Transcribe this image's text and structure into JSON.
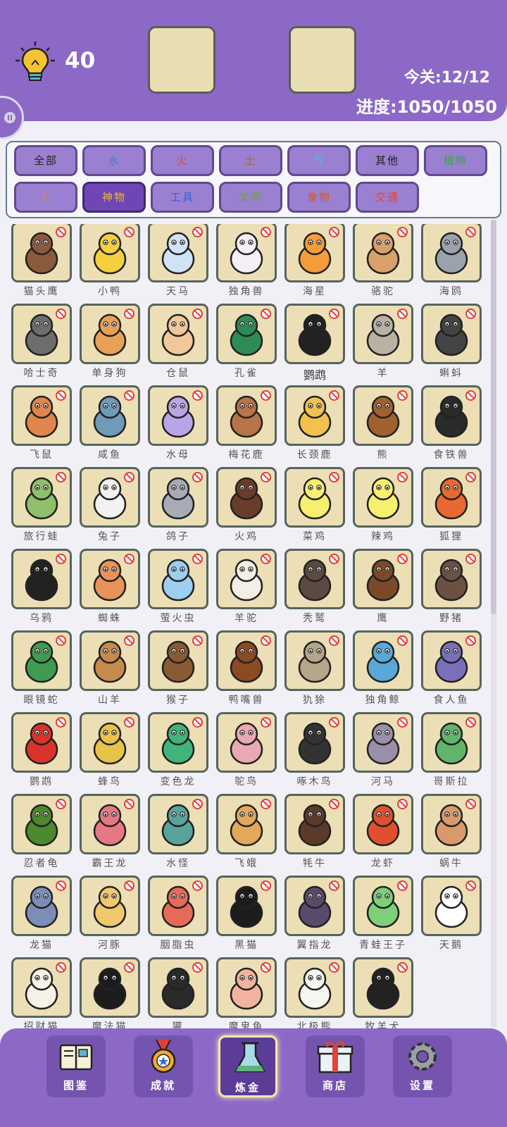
{
  "hints": {
    "count": "40"
  },
  "level": {
    "text": "今关:12/12"
  },
  "progress": {
    "text": "进度:1050/1050"
  },
  "filters": [
    {
      "label": "全部",
      "color": "#222222"
    },
    {
      "label": "水",
      "color": "#3b7fd6"
    },
    {
      "label": "火",
      "color": "#e04a3a"
    },
    {
      "label": "土",
      "color": "#a36b2c"
    },
    {
      "label": "气",
      "color": "#56b7d9"
    },
    {
      "label": "其他",
      "color": "#222222"
    },
    {
      "label": "植物",
      "color": "#3fa14a"
    },
    {
      "label": "人",
      "color": "#d4894a"
    },
    {
      "label": "神物",
      "color": "#f2b531",
      "active": true
    },
    {
      "label": "工具",
      "color": "#3a5fd6"
    },
    {
      "label": "文明",
      "color": "#6fa046"
    },
    {
      "label": "食物",
      "color": "#d05a20"
    },
    {
      "label": "交通",
      "color": "#e0443a"
    }
  ],
  "grid_items": [
    {
      "name": "猫头鹰",
      "icon": "owl-icon",
      "color": "#8b5a3c"
    },
    {
      "name": "小鸭",
      "icon": "duck-icon",
      "color": "#f4d03f"
    },
    {
      "name": "天马",
      "icon": "pegasus-icon",
      "color": "#cfe3f5"
    },
    {
      "name": "独角兽",
      "icon": "unicorn-icon",
      "color": "#f5f0f8"
    },
    {
      "name": "海星",
      "icon": "starfish-icon",
      "color": "#f39c3c"
    },
    {
      "name": "骆驼",
      "icon": "camel-icon",
      "color": "#d9a06b"
    },
    {
      "name": "海鸥",
      "icon": "seagull-icon",
      "color": "#9aa3ad"
    },
    {
      "name": "哈士奇",
      "icon": "husky-icon",
      "color": "#6d6d6d"
    },
    {
      "name": "单身狗",
      "icon": "dog-icon",
      "color": "#e6a157"
    },
    {
      "name": "仓鼠",
      "icon": "hamster-icon",
      "color": "#f1c89a"
    },
    {
      "name": "孔雀",
      "icon": "peacock-icon",
      "color": "#2e8b57"
    },
    {
      "name": "鹦鹉",
      "icon": "toucan-icon",
      "color": "#222222",
      "plain": true
    },
    {
      "name": "羊",
      "icon": "goat-icon",
      "color": "#b9b1a3"
    },
    {
      "name": "蝌蚪",
      "icon": "tadpole-icon",
      "color": "#444444"
    },
    {
      "name": "飞鼠",
      "icon": "flying-squirrel-icon",
      "color": "#e0864a"
    },
    {
      "name": "咸鱼",
      "icon": "salted-fish-icon",
      "color": "#6f9ab8"
    },
    {
      "name": "水母",
      "icon": "jellyfish-icon",
      "color": "#b9a5e6"
    },
    {
      "name": "梅花鹿",
      "icon": "deer-icon",
      "color": "#b8734a"
    },
    {
      "name": "长颈鹿",
      "icon": "giraffe-icon",
      "color": "#f2c14e"
    },
    {
      "name": "熊",
      "icon": "bear-icon",
      "color": "#a0612e"
    },
    {
      "name": "食铁兽",
      "icon": "panda-icon",
      "color": "#2b2b2b"
    },
    {
      "name": "旅行蛙",
      "icon": "frog-icon",
      "color": "#8fbf6a"
    },
    {
      "name": "兔子",
      "icon": "rabbit-icon",
      "color": "#f2f2f2"
    },
    {
      "name": "鸽子",
      "icon": "pigeon-icon",
      "color": "#a6abb5"
    },
    {
      "name": "火鸡",
      "icon": "turkey-icon",
      "color": "#6a3d2a"
    },
    {
      "name": "菜鸡",
      "icon": "chick-icon",
      "color": "#f7ef6e"
    },
    {
      "name": "辣鸡",
      "icon": "spicy-chick-icon",
      "color": "#f7ef6e"
    },
    {
      "name": "狐狸",
      "icon": "fox-icon",
      "color": "#e8692f"
    },
    {
      "name": "乌鸦",
      "icon": "crow-icon",
      "color": "#222222"
    },
    {
      "name": "蜘蛛",
      "icon": "spider-icon",
      "color": "#e8935a"
    },
    {
      "name": "萤火虫",
      "icon": "firefly-icon",
      "color": "#9dcff0"
    },
    {
      "name": "羊驼",
      "icon": "alpaca-icon",
      "color": "#f3efe6"
    },
    {
      "name": "秃鹫",
      "icon": "vulture-icon",
      "color": "#5a4a42"
    },
    {
      "name": "鹰",
      "icon": "eagle-icon",
      "color": "#7a4a28"
    },
    {
      "name": "野猪",
      "icon": "boar-icon",
      "color": "#6b5144"
    },
    {
      "name": "眼镜蛇",
      "icon": "snake-icon",
      "color": "#3e9b50"
    },
    {
      "name": "山羊",
      "icon": "mountain-goat-icon",
      "color": "#c68a4c"
    },
    {
      "name": "猴子",
      "icon": "monkey-icon",
      "color": "#8a5a32"
    },
    {
      "name": "鸭嘴兽",
      "icon": "platypus-icon",
      "color": "#8a4a22"
    },
    {
      "name": "犰狳",
      "icon": "armadillo-icon",
      "color": "#b6a58a"
    },
    {
      "name": "独角鲸",
      "icon": "narwhal-icon",
      "color": "#5aa8d8"
    },
    {
      "name": "食人鱼",
      "icon": "piranha-icon",
      "color": "#7a6fb8"
    },
    {
      "name": "鹦鹉",
      "icon": "parrot-icon",
      "color": "#d9332b"
    },
    {
      "name": "蜂鸟",
      "icon": "hummingbird-icon",
      "color": "#e7c34a"
    },
    {
      "name": "变色龙",
      "icon": "chameleon-icon",
      "color": "#3fb57a"
    },
    {
      "name": "鸵鸟",
      "icon": "ostrich-icon",
      "color": "#e8a9b3"
    },
    {
      "name": "啄木鸟",
      "icon": "woodpecker-icon",
      "color": "#333333"
    },
    {
      "name": "河马",
      "icon": "hippo-icon",
      "color": "#9a8fab"
    },
    {
      "name": "哥斯拉",
      "icon": "godzilla-icon",
      "color": "#5fb56b"
    },
    {
      "name": "忍者龟",
      "icon": "ninja-turtle-icon",
      "color": "#4a8a2c"
    },
    {
      "name": "霸王龙",
      "icon": "trex-icon",
      "color": "#e57983"
    },
    {
      "name": "水怪",
      "icon": "sea-monster-icon",
      "color": "#5aa39a"
    },
    {
      "name": "飞蛾",
      "icon": "moth-icon",
      "color": "#e3a85a"
    },
    {
      "name": "牦牛",
      "icon": "yak-icon",
      "color": "#5a3a28"
    },
    {
      "name": "龙虾",
      "icon": "lobster-icon",
      "color": "#e0502e"
    },
    {
      "name": "蜗牛",
      "icon": "snail-icon",
      "color": "#d89a6a"
    },
    {
      "name": "龙猫",
      "icon": "totoro-icon",
      "color": "#7c8db8"
    },
    {
      "name": "河豚",
      "icon": "pufferfish-icon",
      "color": "#f0c86e"
    },
    {
      "name": "胭脂虫",
      "icon": "cochineal-icon",
      "color": "#e66a5a"
    },
    {
      "name": "黑猫",
      "icon": "black-cat-icon",
      "color": "#1c1c1c"
    },
    {
      "name": "翼指龙",
      "icon": "pterodactyl-icon",
      "color": "#5a4a6a"
    },
    {
      "name": "青蛙王子",
      "icon": "frog-prince-icon",
      "color": "#7dcf7a"
    },
    {
      "name": "天鹅",
      "icon": "swan-icon",
      "color": "#ffffff"
    },
    {
      "name": "招财猫",
      "icon": "lucky-cat-icon",
      "color": "#f7f2e8"
    },
    {
      "name": "魔法猫",
      "icon": "witch-cat-icon",
      "color": "#1c1c1c"
    },
    {
      "name": "獾",
      "icon": "badger-icon",
      "color": "#2a2a2a"
    },
    {
      "name": "魔鬼鱼",
      "icon": "manta-ray-icon",
      "color": "#f0b3a0"
    },
    {
      "name": "北极熊",
      "icon": "polar-bear-icon",
      "color": "#f7f7f2"
    },
    {
      "name": "牧羊犬",
      "icon": "collie-icon",
      "color": "#222222"
    }
  ],
  "nav": [
    {
      "label": "图鉴",
      "icon": "book-icon"
    },
    {
      "label": "成就",
      "icon": "medal-icon"
    },
    {
      "label": "炼金",
      "icon": "flask-icon",
      "active": true
    },
    {
      "label": "商店",
      "icon": "gift-icon"
    },
    {
      "label": "设置",
      "icon": "gear-icon"
    }
  ]
}
